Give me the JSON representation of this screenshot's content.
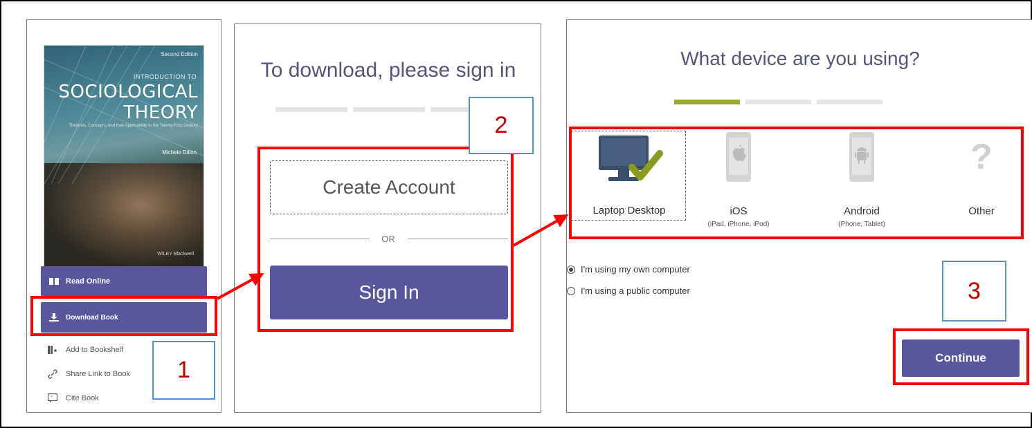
{
  "panel1": {
    "cover": {
      "edition": "Second Edition",
      "intro": "INTRODUCTION TO",
      "title_line1": "SOCIOLOGICAL",
      "title_line2": "THEORY",
      "subtitle": "Theorists, Concepts, and their Applicability to the Twenty-First Century",
      "author": "Michele Dillon",
      "publisher": "WILEY Blackwell"
    },
    "buttons": {
      "read_online": "Read Online",
      "download_book": "Download Book"
    },
    "links": [
      {
        "label": "Add to Bookshelf",
        "icon": "add-to-bookshelf-icon"
      },
      {
        "label": "Share Link to Book",
        "icon": "share-link-icon"
      },
      {
        "label": "Cite Book",
        "icon": "cite-icon"
      }
    ]
  },
  "panel2": {
    "title": "To download, please sign in",
    "create_account": "Create Account",
    "or": "OR",
    "sign_in": "Sign In"
  },
  "panel3": {
    "title": "What device are you using?",
    "devices": [
      {
        "name": "Laptop Desktop",
        "sub": "",
        "icon": "laptop-desktop-icon",
        "selected": true
      },
      {
        "name": "iOS",
        "sub": "(iPad, iPhone, iPod)",
        "icon": "ios-device-icon",
        "selected": false
      },
      {
        "name": "Android",
        "sub": "(Phone, Tablet)",
        "icon": "android-device-icon",
        "selected": false
      },
      {
        "name": "Other",
        "sub": "",
        "icon": "question-mark-icon",
        "selected": false
      }
    ],
    "radio_options": [
      {
        "label": "I'm using my own computer",
        "checked": true
      },
      {
        "label": "I'm using a public computer",
        "checked": false
      }
    ],
    "continue": "Continue"
  },
  "annotations": {
    "step1": "1",
    "step2": "2",
    "step3": "3"
  },
  "colors": {
    "accent_purple": "#5a559f",
    "annotation_red": "#ff0000",
    "annotation_blue": "#5b8ecb",
    "step_number": "#c00000",
    "progress_active": "#9aab2c",
    "checkmark": "#8a9b1f"
  }
}
